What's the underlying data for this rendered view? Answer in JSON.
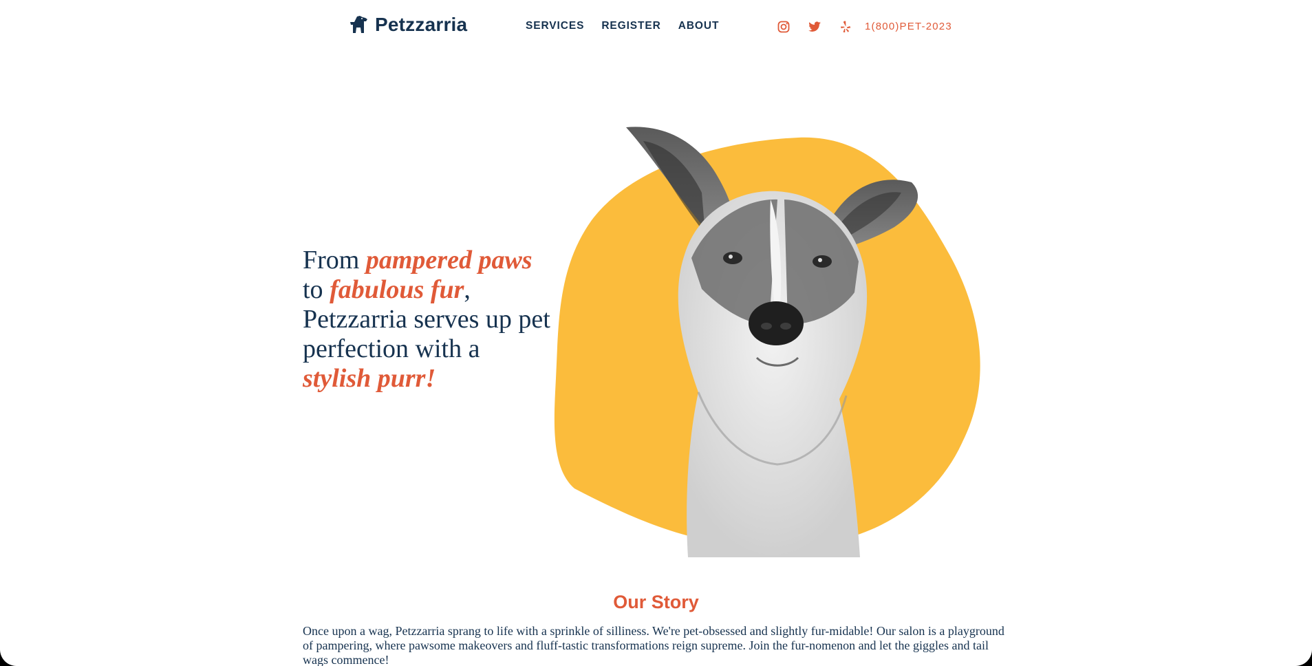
{
  "header": {
    "brand": "Petzzarria",
    "nav": [
      "SERVICES",
      "REGISTER",
      "ABOUT"
    ],
    "social_icons": [
      "instagram-icon",
      "twitter-icon",
      "yelp-icon"
    ],
    "phone": "1(800)PET-2023"
  },
  "hero": {
    "parts": [
      "From ",
      "pampered paws",
      " to ",
      "fabulous fur",
      ", Petzzarria serves up pet perfection with a ",
      "stylish purr!"
    ],
    "image": "dog-portrait",
    "blob_color": "#fbbc3c"
  },
  "story": {
    "title": "Our Story",
    "body": "Once upon a wag, Petzzarria sprang to life with a sprinkle of silliness. We're pet-obsessed and slightly fur-midable! Our salon is a playground of pampering, where pawsome makeovers and fluff-tastic transformations reign supreme. Join the fur-nomenon and let the giggles and tail wags commence!"
  },
  "colors": {
    "navy": "#16324f",
    "accent": "#e05a38",
    "yellow": "#fbbc3c"
  }
}
